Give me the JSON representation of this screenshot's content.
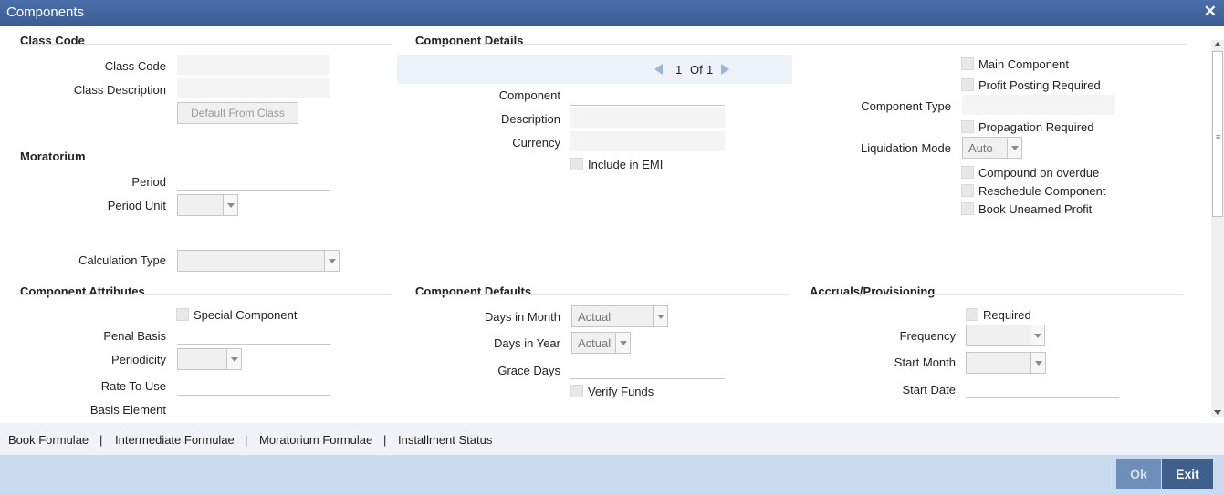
{
  "window": {
    "title": "Components",
    "close_glyph": "✕"
  },
  "class_code": {
    "heading": "Class Code",
    "class_code_label": "Class Code",
    "class_description_label": "Class Description",
    "default_button": "Default From Class"
  },
  "moratorium": {
    "heading": "Moratorium",
    "period_label": "Period",
    "period_unit_label": "Period Unit"
  },
  "calculation_type_label": "Calculation Type",
  "component_details": {
    "heading": "Component Details",
    "pager": {
      "current": "1",
      "of_label": "Of",
      "total": "1"
    },
    "component_label": "Component",
    "description_label": "Description",
    "currency_label": "Currency",
    "include_in_emi": "Include in EMI"
  },
  "right_panel": {
    "main_component": "Main Component",
    "profit_posting_required": "Profit Posting Required",
    "component_type_label": "Component Type",
    "propagation_required": "Propagation Required",
    "liquidation_mode_label": "Liquidation Mode",
    "liquidation_mode_value": "Auto",
    "compound_on_overdue": "Compound on overdue",
    "reschedule_component": "Reschedule Component",
    "book_unearned_profit": "Book Unearned Profit"
  },
  "component_attributes": {
    "heading": "Component Attributes",
    "special_component": "Special Component",
    "penal_basis_label": "Penal Basis",
    "periodicity_label": "Periodicity",
    "rate_to_use_label": "Rate To Use",
    "basis_element_label": "Basis Element"
  },
  "component_defaults": {
    "heading": "Component Defaults",
    "days_in_month_label": "Days in Month",
    "days_in_month_value": "Actual",
    "days_in_year_label": "Days in Year",
    "days_in_year_value": "Actual",
    "grace_days_label": "Grace Days",
    "verify_funds": "Verify Funds"
  },
  "accruals": {
    "heading": "Accruals/Provisioning",
    "required": "Required",
    "frequency_label": "Frequency",
    "start_month_label": "Start Month",
    "start_date_label": "Start Date"
  },
  "tabs": [
    {
      "label": "Book Formulae"
    },
    {
      "label": "Intermediate Formulae"
    },
    {
      "label": "Moratorium Formulae"
    },
    {
      "label": "Installment Status"
    }
  ],
  "tab_separator": "|",
  "footer": {
    "ok": "Ok",
    "exit": "Exit"
  },
  "colors": {
    "titlebar": "#3f63a0",
    "footer": "#c9dbee",
    "exit_button": "#3f5f8c"
  }
}
